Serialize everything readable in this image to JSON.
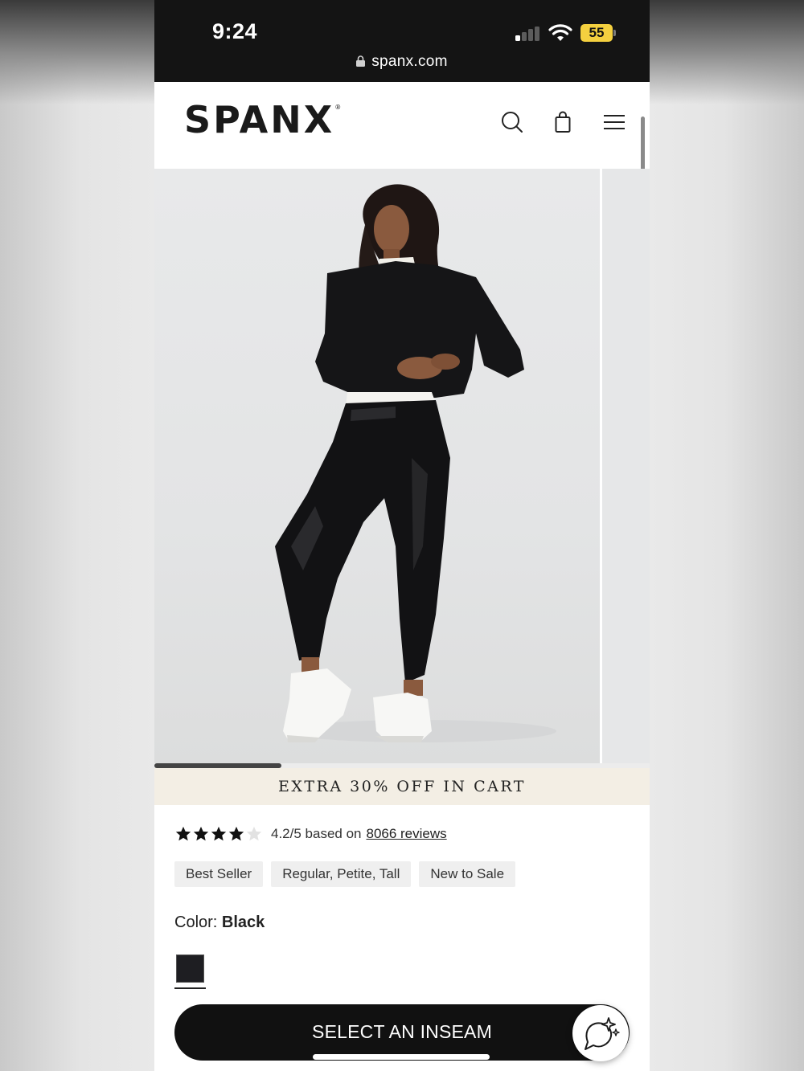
{
  "status_bar": {
    "time": "9:24",
    "battery": "55",
    "url": "spanx.com",
    "battery_color": "#f4d03f"
  },
  "header": {
    "logo": "SPANX",
    "logo_mark": "®",
    "icons": [
      "search-icon",
      "shopping-bag-icon",
      "menu-icon"
    ]
  },
  "gallery": {
    "image_description_icon": "product-photo",
    "position": "1"
  },
  "promo": {
    "text": "EXTRA 30% OFF IN CART",
    "background": "#f3eee4"
  },
  "reviews": {
    "rating_value": 4.2,
    "rating_max": 5,
    "rating_text": "4.2/5 based on",
    "link_text": "8066 reviews"
  },
  "tags": [
    "Best Seller",
    "Regular, Petite, Tall",
    "New to Sale"
  ],
  "color": {
    "label": "Color:",
    "value": "Black",
    "swatch": "#1e1e22"
  },
  "cta": {
    "label": "SELECT AN INSEAM"
  },
  "chat": {
    "icon": "chat-sparkle-icon"
  }
}
